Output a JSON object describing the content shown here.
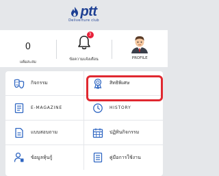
{
  "logo": {
    "brand": "ptt",
    "subtitle": "Deliverture club"
  },
  "stats": {
    "points_value": "0",
    "points_label": "แต้มสะสม",
    "notification_count": "3",
    "notifications_label": "ข้อความแจ้งเตือน",
    "profile_label": "PROFILE"
  },
  "menu": [
    {
      "label": "กิจกรรม",
      "icon": "mask-icon"
    },
    {
      "label": "สิทธิพิเศษ",
      "icon": "award-ribbon-icon",
      "highlighted": true
    },
    {
      "label": "E-MAGAZINE",
      "icon": "magazine-icon"
    },
    {
      "label": "HISTORY",
      "icon": "clock-history-icon"
    },
    {
      "label": "แบบสอบถาม",
      "icon": "survey-document-icon"
    },
    {
      "label": "ปฏิทินกิจกรรม",
      "icon": "calendar-icon"
    },
    {
      "label": "ข้อมูลหุ้นกู้",
      "icon": "bond-info-icon"
    },
    {
      "label": "คู่มือการใช้งาน",
      "icon": "user-manual-icon"
    }
  ],
  "colors": {
    "brand_blue": "#1d3f93",
    "icon_blue": "#2f66c2",
    "badge_red": "#e8203a",
    "highlight_red": "#e02830"
  }
}
